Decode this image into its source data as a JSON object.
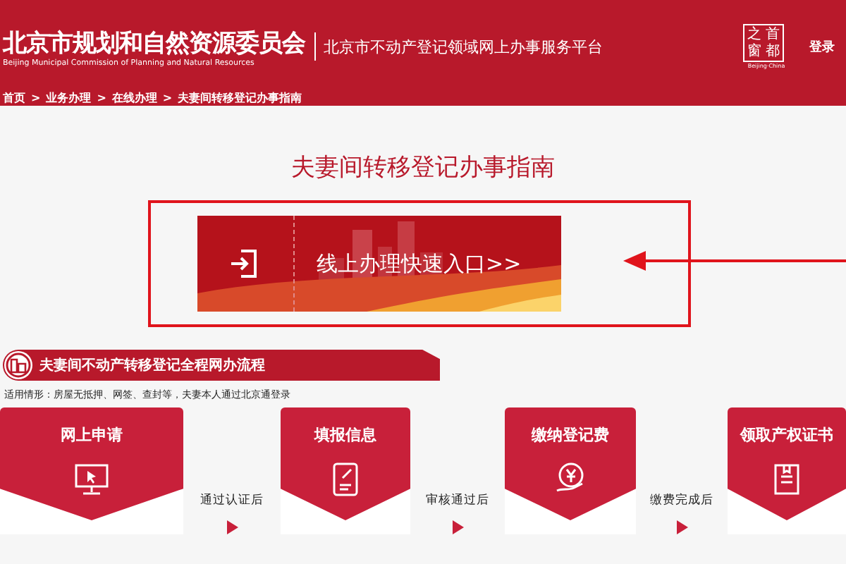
{
  "header": {
    "title": "北京市规划和自然资源委员会",
    "subtitle": "Beijing Municipal Commission of Planning and Natural Resources",
    "platform": "北京市不动产登记领域网上办事服务平台",
    "logo": {
      "chars": [
        "之",
        "首",
        "窗",
        "都"
      ],
      "caption": "Beijing·China"
    },
    "login": "登录"
  },
  "breadcrumb": [
    "首页",
    "业务办理",
    "在线办理",
    "夫妻间转移登记办事指南"
  ],
  "breadcrumb_separator": ">",
  "page_title": "夫妻间转移登记办事指南",
  "quick_entry": {
    "label": "线上办理快速入口>>"
  },
  "process": {
    "title": "夫妻间不动产转移登记全程网办流程",
    "note": "适用情形：房屋无抵押、网签、查封等，夫妻本人通过北京通登录",
    "steps": [
      {
        "title": "网上申请",
        "connector": "通过认证后"
      },
      {
        "title": "填报信息",
        "connector": "审核通过后"
      },
      {
        "title": "缴纳登记费",
        "connector": "缴费完成后"
      },
      {
        "title": "领取产权证书"
      }
    ]
  }
}
